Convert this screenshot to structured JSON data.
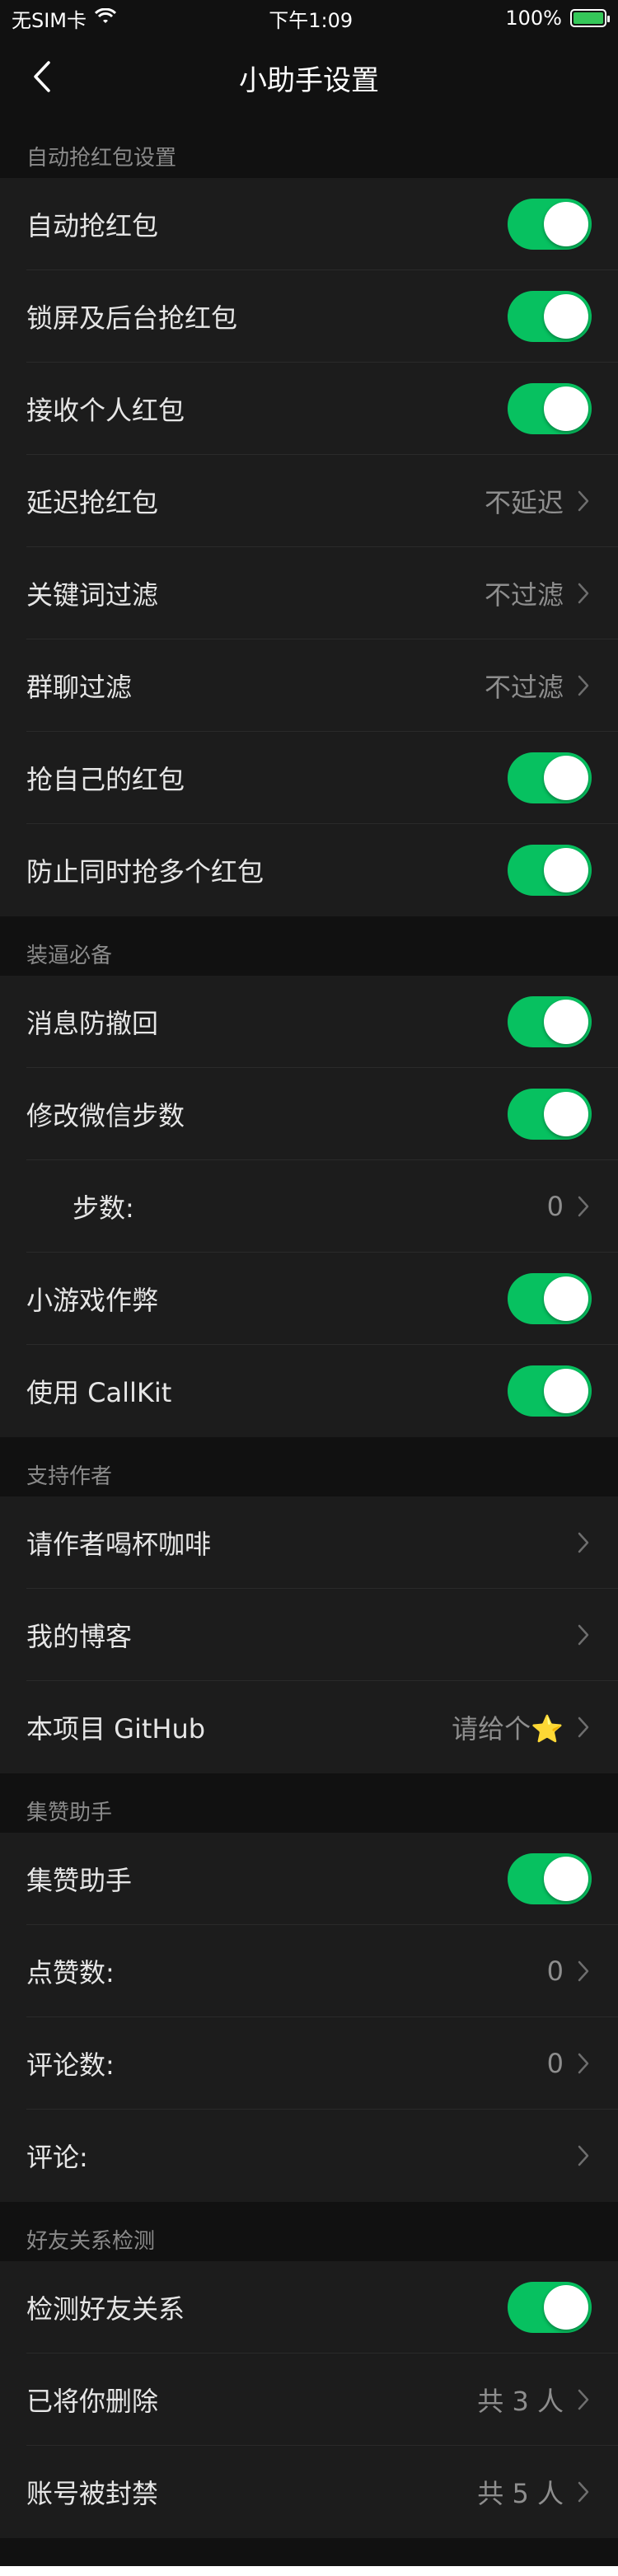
{
  "status_bar": {
    "carrier": "无SIM卡",
    "time": "下午1:09",
    "battery": "100%"
  },
  "nav": {
    "title": "小助手设置"
  },
  "sections": [
    {
      "header": "自动抢红包设置",
      "rows": [
        {
          "label": "自动抢红包",
          "type": "toggle",
          "on": true
        },
        {
          "label": "锁屏及后台抢红包",
          "type": "toggle",
          "on": true
        },
        {
          "label": "接收个人红包",
          "type": "toggle",
          "on": true
        },
        {
          "label": "延迟抢红包",
          "type": "link",
          "value": "不延迟"
        },
        {
          "label": "关键词过滤",
          "type": "link",
          "value": "不过滤"
        },
        {
          "label": "群聊过滤",
          "type": "link",
          "value": "不过滤"
        },
        {
          "label": "抢自己的红包",
          "type": "toggle",
          "on": true
        },
        {
          "label": "防止同时抢多个红包",
          "type": "toggle",
          "on": true
        }
      ]
    },
    {
      "header": "装逼必备",
      "rows": [
        {
          "label": "消息防撤回",
          "type": "toggle",
          "on": true
        },
        {
          "label": "修改微信步数",
          "type": "toggle",
          "on": true
        },
        {
          "label": "步数:",
          "type": "link",
          "value": "0"
        },
        {
          "label": "小游戏作弊",
          "type": "toggle",
          "on": true
        },
        {
          "label": "使用 CallKit",
          "type": "toggle",
          "on": true
        }
      ]
    },
    {
      "header": "支持作者",
      "rows": [
        {
          "label": "请作者喝杯咖啡",
          "type": "link",
          "value": ""
        },
        {
          "label": "我的博客",
          "type": "link",
          "value": ""
        },
        {
          "label": "本项目 GitHub",
          "type": "link",
          "value": "请给个⭐️"
        }
      ]
    },
    {
      "header": "集赞助手",
      "rows": [
        {
          "label": "集赞助手",
          "type": "toggle",
          "on": true
        },
        {
          "label": "点赞数:",
          "type": "link",
          "value": "0"
        },
        {
          "label": "评论数:",
          "type": "link",
          "value": "0"
        },
        {
          "label": "评论:",
          "type": "link",
          "value": ""
        }
      ]
    },
    {
      "header": "好友关系检测",
      "rows": [
        {
          "label": "检测好友关系",
          "type": "toggle",
          "on": true
        },
        {
          "label": "已将你删除",
          "type": "link",
          "value": "共 3 人"
        },
        {
          "label": "账号被封禁",
          "type": "link",
          "value": "共 5 人"
        }
      ]
    }
  ],
  "colors": {
    "toggle_on": "#07c160",
    "background": "#111111",
    "cell": "#1c1c1c"
  }
}
